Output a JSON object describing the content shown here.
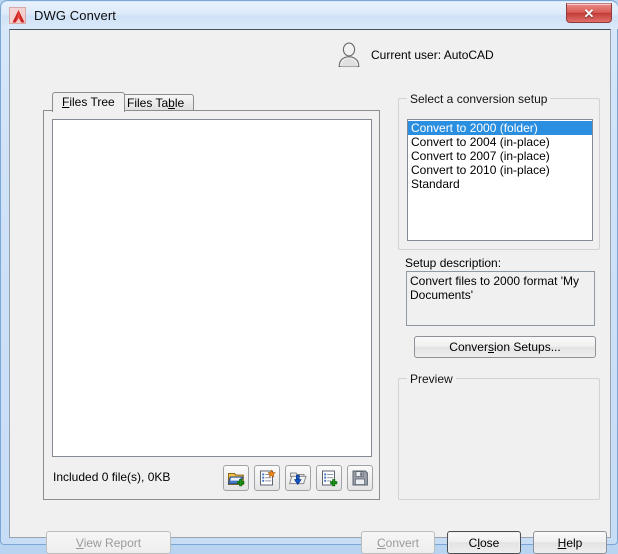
{
  "window": {
    "title": "DWG Convert",
    "app_icon": "autocad-logo-icon",
    "close_label": "✕"
  },
  "header": {
    "user_icon": "user-silhouette-icon",
    "current_user": "Current user: AutoCAD"
  },
  "tabs": [
    {
      "label": "Files Tree",
      "accel": "F",
      "active": true
    },
    {
      "label": "Files Table",
      "accel": "b",
      "active": false
    }
  ],
  "files_panel": {
    "tree_items": [],
    "status": "Included 0 file(s), 0KB",
    "toolbar": [
      {
        "name": "add-file-icon",
        "title": "Add File"
      },
      {
        "name": "add-drawing-icon",
        "title": "Add Drawing"
      },
      {
        "name": "open-folder-icon",
        "title": "Open Folder"
      },
      {
        "name": "add-list-icon",
        "title": "Add List"
      },
      {
        "name": "save-list-icon",
        "title": "Save List"
      }
    ]
  },
  "conversion_setup": {
    "legend": "Select a conversion setup",
    "items": [
      "Convert to 2000 (folder)",
      "Convert to 2004 (in-place)",
      "Convert to 2007 (in-place)",
      "Convert to 2010 (in-place)",
      "Standard"
    ],
    "selected_index": 0,
    "selection_color": "#2a8fe0"
  },
  "description": {
    "label": "Setup description:",
    "text": "Convert files to 2000 format 'My Documents'"
  },
  "conversion_setups_button": {
    "label": "Conversion Setups...",
    "accel": "S"
  },
  "preview": {
    "legend": "Preview",
    "content": ""
  },
  "footer": {
    "view_report": {
      "label": "View Report",
      "accel": "V",
      "enabled": false
    },
    "convert": {
      "label": "Convert",
      "accel": "C",
      "enabled": false
    },
    "close": {
      "label": "Close",
      "accel": "l",
      "enabled": true,
      "default": true
    },
    "help": {
      "label": "Help",
      "accel": "H",
      "enabled": true
    }
  }
}
